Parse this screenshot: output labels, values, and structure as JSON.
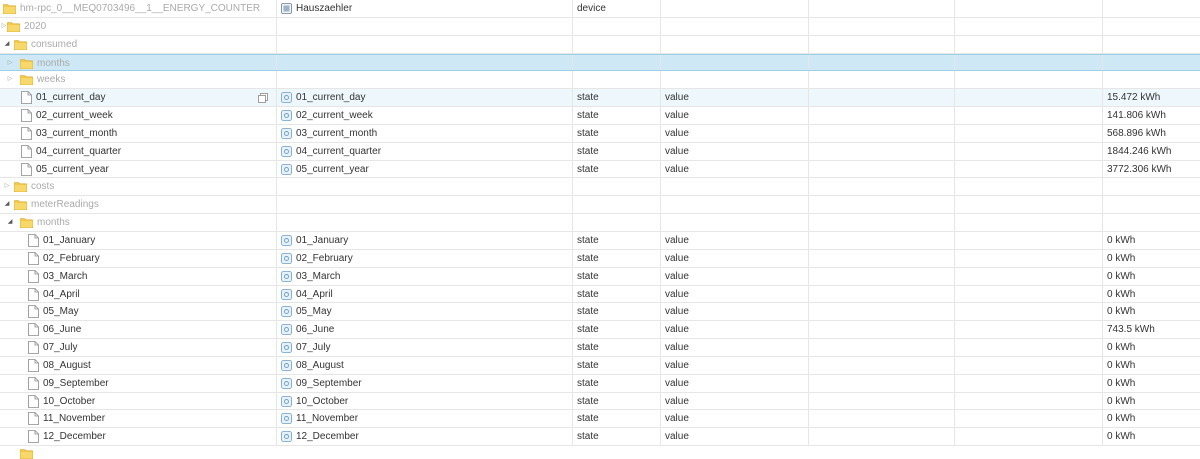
{
  "colors": {
    "folder": "#f2c94c",
    "selected_row": "#cfe8f6",
    "hover_row": "#eef7fc",
    "state_icon": "#6a9fc9"
  },
  "tree": {
    "device_row": {
      "name": "hm-rpc_0__MEQ0703496__1__ENERGY_COUNTER",
      "object_name": "Hauszaehler",
      "type": "device"
    },
    "year_row": {
      "name": "2020"
    },
    "consumed_row": {
      "name": "consumed"
    },
    "consumed_months_row": {
      "name": "months"
    },
    "consumed_weeks_row": {
      "name": "weeks"
    },
    "current_rows": [
      {
        "name": "01_current_day",
        "object_name": "01_current_day",
        "type": "state",
        "role": "value",
        "value": "15.472 kWh"
      },
      {
        "name": "02_current_week",
        "object_name": "02_current_week",
        "type": "state",
        "role": "value",
        "value": "141.806 kWh"
      },
      {
        "name": "03_current_month",
        "object_name": "03_current_month",
        "type": "state",
        "role": "value",
        "value": "568.896 kWh"
      },
      {
        "name": "04_current_quarter",
        "object_name": "04_current_quarter",
        "type": "state",
        "role": "value",
        "value": "1844.246 kWh"
      },
      {
        "name": "05_current_year",
        "object_name": "05_current_year",
        "type": "state",
        "role": "value",
        "value": "3772.306 kWh"
      }
    ],
    "costs_row": {
      "name": "costs"
    },
    "meter_row": {
      "name": "meterReadings"
    },
    "meter_months_row": {
      "name": "months"
    },
    "month_rows": [
      {
        "name": "01_January",
        "object_name": "01_January",
        "type": "state",
        "role": "value",
        "value": "0 kWh"
      },
      {
        "name": "02_February",
        "object_name": "02_February",
        "type": "state",
        "role": "value",
        "value": "0 kWh"
      },
      {
        "name": "03_March",
        "object_name": "03_March",
        "type": "state",
        "role": "value",
        "value": "0 kWh"
      },
      {
        "name": "04_April",
        "object_name": "04_April",
        "type": "state",
        "role": "value",
        "value": "0 kWh"
      },
      {
        "name": "05_May",
        "object_name": "05_May",
        "type": "state",
        "role": "value",
        "value": "0 kWh"
      },
      {
        "name": "06_June",
        "object_name": "06_June",
        "type": "state",
        "role": "value",
        "value": "743.5 kWh"
      },
      {
        "name": "07_July",
        "object_name": "07_July",
        "type": "state",
        "role": "value",
        "value": "0 kWh"
      },
      {
        "name": "08_August",
        "object_name": "08_August",
        "type": "state",
        "role": "value",
        "value": "0 kWh"
      },
      {
        "name": "09_September",
        "object_name": "09_September",
        "type": "state",
        "role": "value",
        "value": "0 kWh"
      },
      {
        "name": "10_October",
        "object_name": "10_October",
        "type": "state",
        "role": "value",
        "value": "0 kWh"
      },
      {
        "name": "11_November",
        "object_name": "11_November",
        "type": "state",
        "role": "value",
        "value": "0 kWh"
      },
      {
        "name": "12_December",
        "object_name": "12_December",
        "type": "state",
        "role": "value",
        "value": "0 kWh"
      }
    ]
  }
}
